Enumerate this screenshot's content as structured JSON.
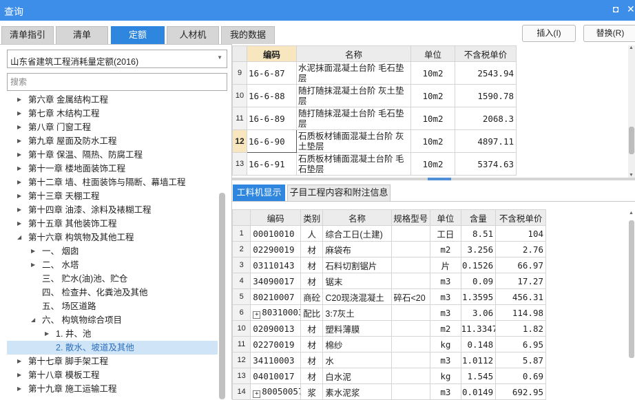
{
  "window": {
    "title": "查询",
    "restore_glyph": "◘",
    "close_glyph": "✕"
  },
  "tabs": [
    {
      "label": "清单指引",
      "active": false
    },
    {
      "label": "清单",
      "active": false
    },
    {
      "label": "定额",
      "active": true
    },
    {
      "label": "人材机",
      "active": false
    },
    {
      "label": "我的数据",
      "active": false
    }
  ],
  "buttons": {
    "insert": "插入(I)",
    "replace": "替换(R)"
  },
  "left": {
    "quota_library": "山东省建筑工程消耗量定额(2016)",
    "search_placeholder": "搜索",
    "tree": [
      {
        "label": "第六章 金属结构工程",
        "toggle": "▶",
        "level": 0
      },
      {
        "label": "第七章 木结构工程",
        "toggle": "▶",
        "level": 0
      },
      {
        "label": "第八章 门窗工程",
        "toggle": "▶",
        "level": 0
      },
      {
        "label": "第九章 屋面及防水工程",
        "toggle": "▶",
        "level": 0
      },
      {
        "label": "第十章 保温、隔热、防腐工程",
        "toggle": "▶",
        "level": 0
      },
      {
        "label": "第十一章 楼地面装饰工程",
        "toggle": "▶",
        "level": 0
      },
      {
        "label": "第十二章 墙、柱面装饰与隔断、幕墙工程",
        "toggle": "▶",
        "level": 0
      },
      {
        "label": "第十三章 天棚工程",
        "toggle": "▶",
        "level": 0
      },
      {
        "label": "第十四章 油漆、涂料及裱糊工程",
        "toggle": "▶",
        "level": 0
      },
      {
        "label": "第十五章 其他装饰工程",
        "toggle": "▶",
        "level": 0
      },
      {
        "label": "第十六章 构筑物及其他工程",
        "toggle": "◢",
        "level": 0
      },
      {
        "label": "一、 烟囱",
        "toggle": "▶",
        "level": 1
      },
      {
        "label": "二、 水塔",
        "toggle": "▶",
        "level": 1
      },
      {
        "label": "三、 贮水(油)池、贮仓",
        "toggle": "",
        "level": 1
      },
      {
        "label": "四、 检查井、化粪池及其他",
        "toggle": "",
        "level": 1
      },
      {
        "label": "五、 场区道路",
        "toggle": "",
        "level": 1
      },
      {
        "label": "六、 构筑物综合项目",
        "toggle": "◢",
        "level": 1
      },
      {
        "label": "1. 井、池",
        "toggle": "▶",
        "level": 2
      },
      {
        "label": "2. 散水、坡道及其他",
        "toggle": "",
        "level": 2,
        "selected": true
      },
      {
        "label": "第十七章 脚手架工程",
        "toggle": "▶",
        "level": 0
      },
      {
        "label": "第十八章 模板工程",
        "toggle": "▶",
        "level": 0
      },
      {
        "label": "第十九章 施工运输工程",
        "toggle": "▶",
        "level": 0
      }
    ]
  },
  "quota_table": {
    "headers": [
      "编码",
      "名称",
      "单位",
      "不含税单价"
    ],
    "rows": [
      {
        "no": "9",
        "code": "16-6-87",
        "name": "水泥抹面混凝土台阶 毛石垫层",
        "unit": "10m2",
        "price": "2543.94"
      },
      {
        "no": "10",
        "code": "16-6-88",
        "name": "随打随抹混凝土台阶 灰土垫层",
        "unit": "10m2",
        "price": "1590.78"
      },
      {
        "no": "11",
        "code": "16-6-89",
        "name": "随打随抹混凝土台阶 毛石垫层",
        "unit": "10m2",
        "price": "2068.3"
      },
      {
        "no": "12",
        "code": "16-6-90",
        "name": "石质板材铺面混凝土台阶 灰土垫层",
        "unit": "10m2",
        "price": "4897.11",
        "current": true
      },
      {
        "no": "13",
        "code": "16-6-91",
        "name": "石质板材铺面混凝土台阶 毛石垫层",
        "unit": "10m2",
        "price": "5374.63"
      }
    ]
  },
  "sub_tabs": [
    {
      "label": "工料机显示",
      "active": true
    },
    {
      "label": "子目工程内容和附注信息",
      "active": false
    }
  ],
  "resource_table": {
    "headers": [
      "编码",
      "类别",
      "名称",
      "规格型号",
      "单位",
      "含量",
      "不含税单价"
    ],
    "rows": [
      {
        "no": "1",
        "code": "00010010",
        "type": "人",
        "name": "综合工日(土建)",
        "spec": "",
        "unit": "工日",
        "qty": "8.51",
        "price": "104",
        "expand": false
      },
      {
        "no": "2",
        "code": "02290019",
        "type": "材",
        "name": "麻袋布",
        "spec": "",
        "unit": "m2",
        "qty": "3.256",
        "price": "2.76",
        "expand": false
      },
      {
        "no": "3",
        "code": "03110143",
        "type": "材",
        "name": "石料切割锯片",
        "spec": "",
        "unit": "片",
        "qty": "0.1526",
        "price": "66.97",
        "expand": false
      },
      {
        "no": "4",
        "code": "34090017",
        "type": "材",
        "name": "锯末",
        "spec": "",
        "unit": "m3",
        "qty": "0.09",
        "price": "17.27",
        "expand": false
      },
      {
        "no": "5",
        "code": "80210007",
        "type": "商砼",
        "name": "C20现浇混凝土",
        "spec": "碎石<20",
        "unit": "m3",
        "qty": "1.3595",
        "price": "456.31",
        "expand": false
      },
      {
        "no": "6",
        "code": "80310003",
        "type": "配比",
        "name": "3:7灰土",
        "spec": "",
        "unit": "m3",
        "qty": "3.06",
        "price": "114.98",
        "expand": true
      },
      {
        "no": "10",
        "code": "02090013",
        "type": "材",
        "name": "塑料薄膜",
        "spec": "",
        "unit": "m2",
        "qty": "11.3347",
        "price": "1.82",
        "expand": false
      },
      {
        "no": "11",
        "code": "02270019",
        "type": "材",
        "name": "棉纱",
        "spec": "",
        "unit": "kg",
        "qty": "0.148",
        "price": "6.95",
        "expand": false
      },
      {
        "no": "12",
        "code": "34110003",
        "type": "材",
        "name": "水",
        "spec": "",
        "unit": "m3",
        "qty": "1.0112",
        "price": "5.87",
        "expand": false
      },
      {
        "no": "13",
        "code": "04010017",
        "type": "材",
        "name": "白水泥",
        "spec": "",
        "unit": "kg",
        "qty": "1.545",
        "price": "0.69",
        "expand": false
      },
      {
        "no": "14",
        "code": "80050057",
        "type": "浆",
        "name": "素水泥浆",
        "spec": "",
        "unit": "m3",
        "qty": "0.0149",
        "price": "692.95",
        "expand": true
      }
    ]
  },
  "colors": {
    "accent": "#2e86de",
    "titlebar": "#3d8ee8",
    "selected_row": "#cfe4f7",
    "current_cell": "#f8e6bf"
  }
}
